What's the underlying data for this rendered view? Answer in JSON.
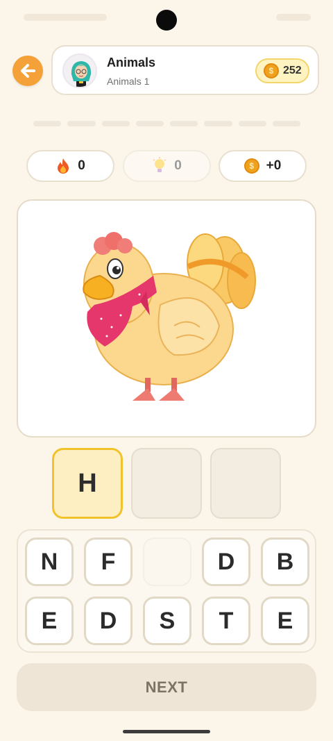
{
  "header": {
    "title": "Animals",
    "subtitle": "Animals 1",
    "coins": "252"
  },
  "stats": {
    "streak": "0",
    "hints": "0",
    "earned": "+0"
  },
  "answer": {
    "slots": [
      "H",
      "",
      ""
    ]
  },
  "keyboard": {
    "row1": [
      "N",
      "F",
      "",
      "D",
      "B"
    ],
    "row2": [
      "E",
      "D",
      "S",
      "T",
      "E"
    ]
  },
  "next_label": "NEXT",
  "colors": {
    "background": "#fcf5ea",
    "accent_orange": "#f5a13a",
    "coin_gold": "#f0a11e",
    "slot_highlight": "#f2c22b"
  },
  "icons": {
    "back": "arrow-left-icon",
    "coin": "coin-icon",
    "streak": "fire-icon",
    "hint": "lightbulb-icon",
    "picture": "hen-illustration"
  }
}
